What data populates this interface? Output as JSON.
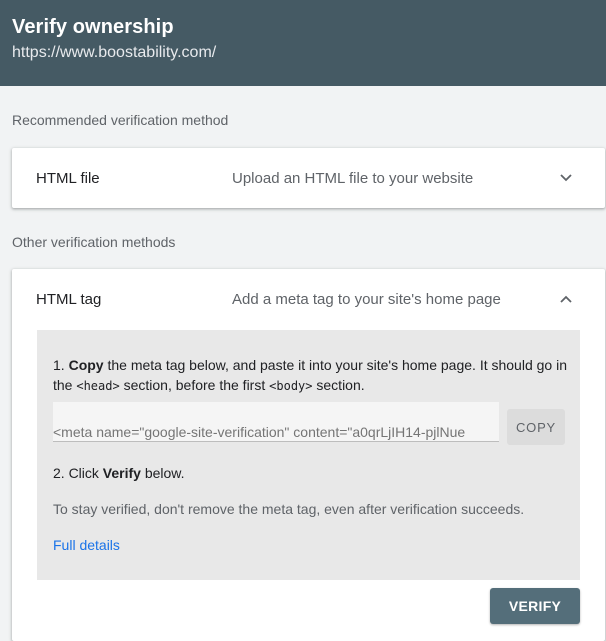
{
  "header": {
    "title": "Verify ownership",
    "url": "https://www.boostability.com/"
  },
  "recommended": {
    "label": "Recommended verification method",
    "method": {
      "title": "HTML file",
      "description": "Upload an HTML file to your website",
      "icon": "chevron-down-icon"
    }
  },
  "other": {
    "label": "Other verification methods",
    "method": {
      "title": "HTML tag",
      "description": "Add a meta tag to your site's home page",
      "icon": "chevron-up-icon"
    }
  },
  "steps": {
    "step1_number": "1.",
    "step1_bold": "Copy",
    "step1_text_a": "the meta tag below, and paste it into your site's home page. It should go in the",
    "step1_head": "<head>",
    "step1_text_b": "section, before the first",
    "step1_body": "<body>",
    "step1_text_c": "section.",
    "meta_tag_value": "<meta name=\"google-site-verification\" content=\"a0qrLjIH14-pjlNue",
    "copy_label": "COPY",
    "step2_prefix": "2. Click",
    "step2_bold": "Verify",
    "step2_suffix": "below.",
    "note": "To stay verified, don't remove the meta tag, even after verification succeeds.",
    "link_label": "Full details"
  },
  "actions": {
    "verify_label": "VERIFY"
  },
  "colors": {
    "header_bg": "#455a64",
    "link": "#1a73e8",
    "verify_bg": "#546e7a"
  }
}
